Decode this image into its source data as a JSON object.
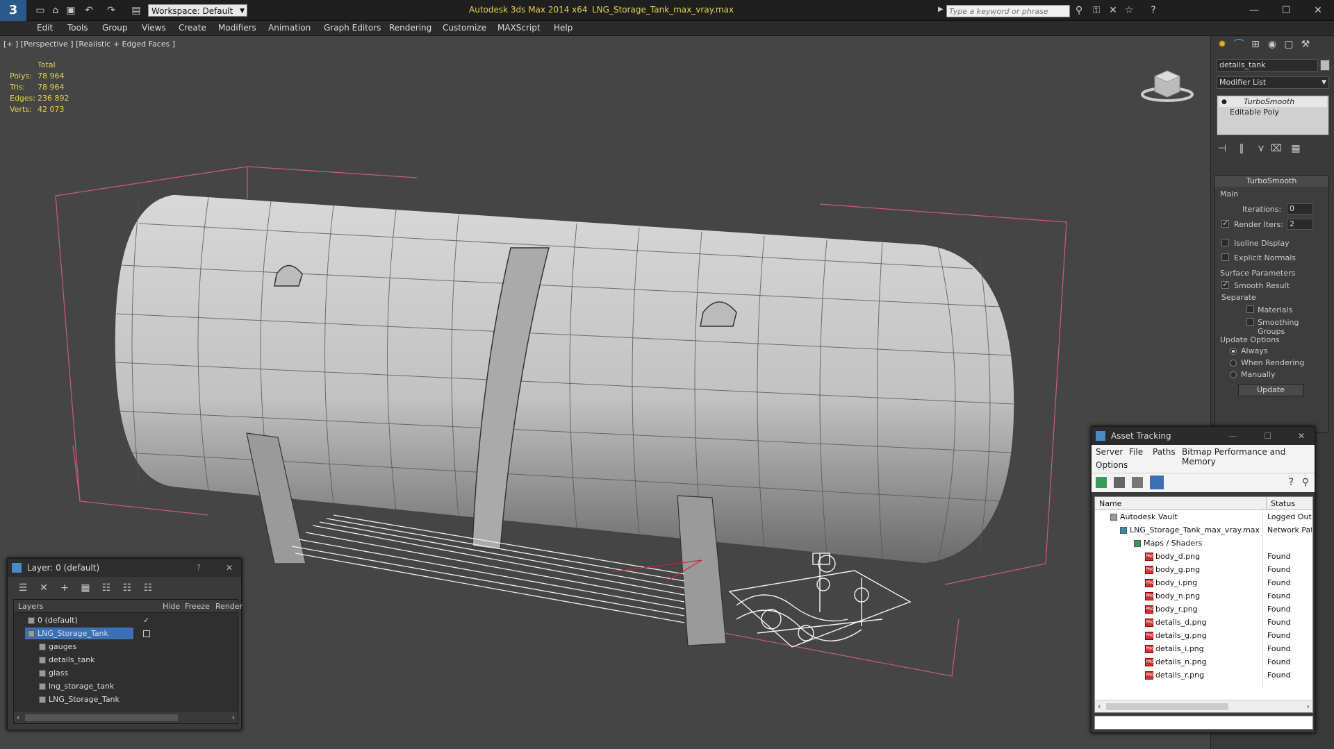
{
  "titlebar": {
    "app_title": "Autodesk 3ds Max  2014 x64",
    "file_title": "LNG_Storage_Tank_max_vray.max",
    "workspace_label": "Workspace: Default",
    "search_placeholder": "Type a keyword or phrase"
  },
  "menu": [
    "Edit",
    "Tools",
    "Group",
    "Views",
    "Create",
    "Modifiers",
    "Animation",
    "Graph Editors",
    "Rendering",
    "Customize",
    "MAXScript",
    "Help"
  ],
  "viewport": {
    "label": "[+ ] [Perspective ] [Realistic + Edged Faces ]",
    "stats": {
      "header": "Total",
      "polys_label": "Polys:",
      "polys": "78 964",
      "tris_label": "Tris:",
      "tris": "78 964",
      "edges_label": "Edges:",
      "edges": "236 892",
      "verts_label": "Verts:",
      "verts": "42 073"
    }
  },
  "cmdpanel": {
    "object_name": "details_tank",
    "modifier_list": "Modifier List",
    "stack": [
      "TurboSmooth",
      "Editable Poly"
    ],
    "rollout_title": "TurboSmooth",
    "main_label": "Main",
    "iterations_label": "Iterations:",
    "iterations": "0",
    "render_iters_label": "Render Iters:",
    "render_iters": "2",
    "isoline": "Isoline Display",
    "explicit_normals": "Explicit Normals",
    "surface_params": "Surface Parameters",
    "smooth_result": "Smooth Result",
    "separate": "Separate",
    "materials": "Materials",
    "smoothing_groups": "Smoothing Groups",
    "update_options": "Update Options",
    "always": "Always",
    "when_rendering": "When Rendering",
    "manually": "Manually",
    "update_btn": "Update"
  },
  "layers": {
    "title": "Layer: 0 (default)",
    "help": "?",
    "col_layers": "Layers",
    "col_hide": "Hide",
    "col_freeze": "Freeze",
    "col_render": "Render",
    "rows": [
      "0 (default)",
      "LNG_Storage_Tank",
      "gauges",
      "details_tank",
      "glass",
      "lng_storage_tank",
      "LNG_Storage_Tank"
    ]
  },
  "assets": {
    "title": "Asset Tracking",
    "menu": [
      "Server",
      "File",
      "Paths",
      "Bitmap Performance and Memory",
      "Options"
    ],
    "col_name": "Name",
    "col_status": "Status",
    "rows": [
      {
        "name": "Autodesk Vault",
        "status": "Logged Out"
      },
      {
        "name": "LNG_Storage_Tank_max_vray.max",
        "status": "Network Path"
      },
      {
        "name": "Maps / Shaders",
        "status": ""
      },
      {
        "name": "body_d.png",
        "status": "Found"
      },
      {
        "name": "body_g.png",
        "status": "Found"
      },
      {
        "name": "body_i.png",
        "status": "Found"
      },
      {
        "name": "body_n.png",
        "status": "Found"
      },
      {
        "name": "body_r.png",
        "status": "Found"
      },
      {
        "name": "details_d.png",
        "status": "Found"
      },
      {
        "name": "details_g.png",
        "status": "Found"
      },
      {
        "name": "details_i.png",
        "status": "Found"
      },
      {
        "name": "details_n.png",
        "status": "Found"
      },
      {
        "name": "details_r.png",
        "status": "Found"
      }
    ]
  },
  "colors": {
    "accent": "#3b6fb6",
    "stats": "#e8d24a",
    "bbox": "#d05a7a"
  }
}
